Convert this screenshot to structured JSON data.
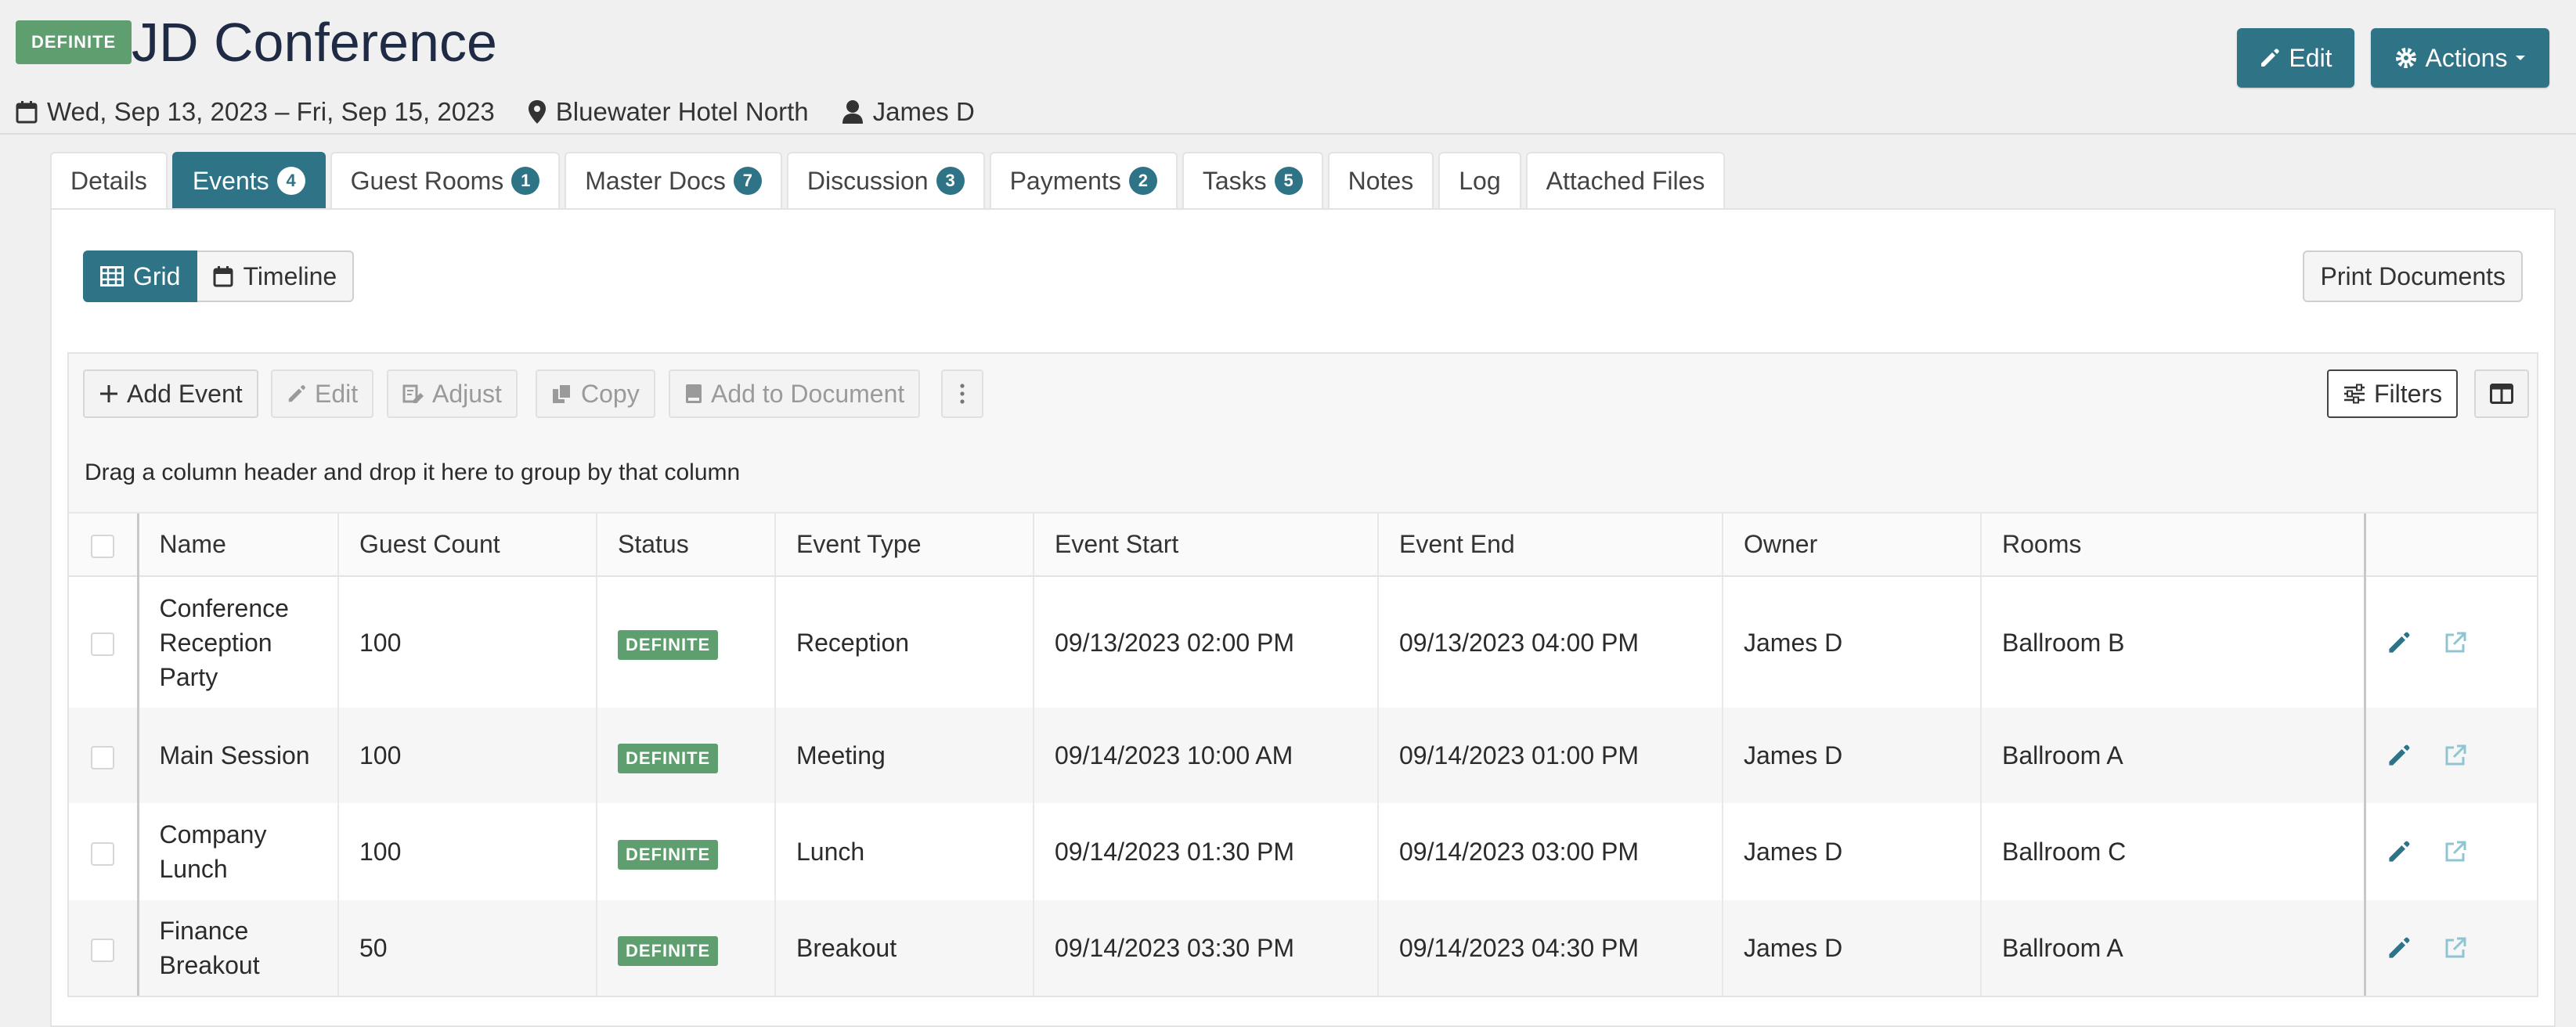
{
  "header": {
    "status": "DEFINITE",
    "title": "JD Conference",
    "dates": "Wed, Sep 13, 2023 – Fri, Sep 15, 2023",
    "location": "Bluewater Hotel North",
    "owner": "James D",
    "edit_label": "Edit",
    "actions_label": "Actions"
  },
  "tabs": [
    {
      "label": "Details",
      "badge": ""
    },
    {
      "label": "Events",
      "badge": "4",
      "active": true
    },
    {
      "label": "Guest Rooms",
      "badge": "1"
    },
    {
      "label": "Master Docs",
      "badge": "7"
    },
    {
      "label": "Discussion",
      "badge": "3"
    },
    {
      "label": "Payments",
      "badge": "2"
    },
    {
      "label": "Tasks",
      "badge": "5"
    },
    {
      "label": "Notes",
      "badge": ""
    },
    {
      "label": "Log",
      "badge": ""
    },
    {
      "label": "Attached Files",
      "badge": ""
    }
  ],
  "view": {
    "grid_label": "Grid",
    "timeline_label": "Timeline",
    "print_label": "Print Documents"
  },
  "toolbar": {
    "add_event": "Add Event",
    "edit": "Edit",
    "adjust": "Adjust",
    "copy": "Copy",
    "add_to_document": "Add to Document",
    "filters": "Filters"
  },
  "group_hint": "Drag a column header and drop it here to group by that column",
  "columns": [
    "Name",
    "Guest Count",
    "Status",
    "Event Type",
    "Event Start",
    "Event End",
    "Owner",
    "Rooms"
  ],
  "rows": [
    {
      "name": "Conference Reception Party",
      "guests": "100",
      "status": "DEFINITE",
      "type": "Reception",
      "start": "09/13/2023 02:00 PM",
      "end": "09/13/2023 04:00 PM",
      "owner": "James D",
      "rooms": "Ballroom B"
    },
    {
      "name": "Main Session",
      "guests": "100",
      "status": "DEFINITE",
      "type": "Meeting",
      "start": "09/14/2023 10:00 AM",
      "end": "09/14/2023 01:00 PM",
      "owner": "James D",
      "rooms": "Ballroom A"
    },
    {
      "name": "Company Lunch",
      "guests": "100",
      "status": "DEFINITE",
      "type": "Lunch",
      "start": "09/14/2023 01:30 PM",
      "end": "09/14/2023 03:00 PM",
      "owner": "James D",
      "rooms": "Ballroom C"
    },
    {
      "name": "Finance Breakout",
      "guests": "50",
      "status": "DEFINITE",
      "type": "Breakout",
      "start": "09/14/2023 03:30 PM",
      "end": "09/14/2023 04:30 PM",
      "owner": "James D",
      "rooms": "Ballroom A"
    }
  ],
  "colors": {
    "accent": "#2e7386",
    "definite": "#5f9e6e"
  }
}
